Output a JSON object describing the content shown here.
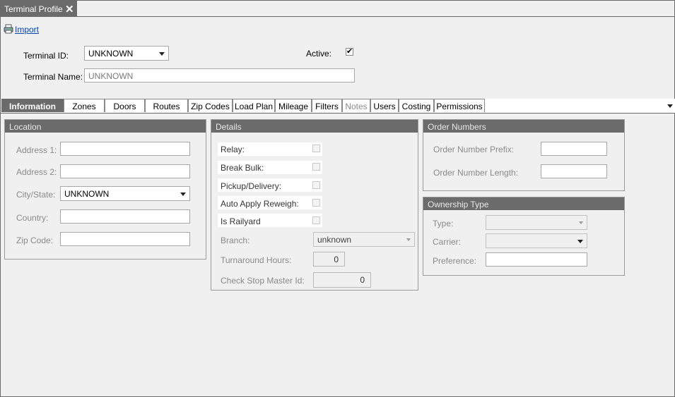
{
  "doc_tab": {
    "title": "Terminal Profile"
  },
  "toolbar": {
    "import_label": "Import"
  },
  "header": {
    "terminal_id_label": "Terminal ID:",
    "terminal_id_value": "UNKNOWN",
    "active_label": "Active:",
    "active_checked": "✔",
    "terminal_name_label": "Terminal Name:",
    "terminal_name_value": "UNKNOWN"
  },
  "tabs": [
    {
      "label": "Information"
    },
    {
      "label": "Zones"
    },
    {
      "label": "Doors"
    },
    {
      "label": "Routes"
    },
    {
      "label": "Zip Codes"
    },
    {
      "label": "Load Plan"
    },
    {
      "label": "Mileage"
    },
    {
      "label": "Filters"
    },
    {
      "label": "Notes"
    },
    {
      "label": "Users"
    },
    {
      "label": "Costing"
    },
    {
      "label": "Permissions"
    }
  ],
  "location": {
    "title": "Location",
    "address1_label": "Address 1:",
    "address1_value": "",
    "address2_label": "Address 2:",
    "address2_value": "",
    "city_state_label": "City/State:",
    "city_state_value": "UNKNOWN",
    "country_label": "Country:",
    "country_value": "",
    "zip_label": "Zip Code:",
    "zip_value": ""
  },
  "details": {
    "title": "Details",
    "relay_label": "Relay:",
    "break_bulk_label": "Break Bulk:",
    "pickup_delivery_label": "Pickup/Delivery:",
    "auto_apply_reweigh_label": "Auto Apply Reweigh:",
    "is_railyard_label": "Is Railyard",
    "branch_label": "Branch:",
    "branch_value": "unknown",
    "turnaround_label": "Turnaround Hours:",
    "turnaround_value": "0",
    "check_stop_label": "Check Stop Master Id:",
    "check_stop_value": "0"
  },
  "order_numbers": {
    "title": "Order Numbers",
    "prefix_label": "Order Number Prefix:",
    "prefix_value": "",
    "length_label": "Order Number Length:",
    "length_value": ""
  },
  "ownership": {
    "title": "Ownership Type",
    "type_label": "Type:",
    "type_value": "",
    "carrier_label": "Carrier:",
    "carrier_value": "",
    "preference_label": "Preference:",
    "preference_value": ""
  },
  "colors": {
    "chrome": "#6b6b6b",
    "link": "#0645ad",
    "panel": "#f0f0f0"
  }
}
